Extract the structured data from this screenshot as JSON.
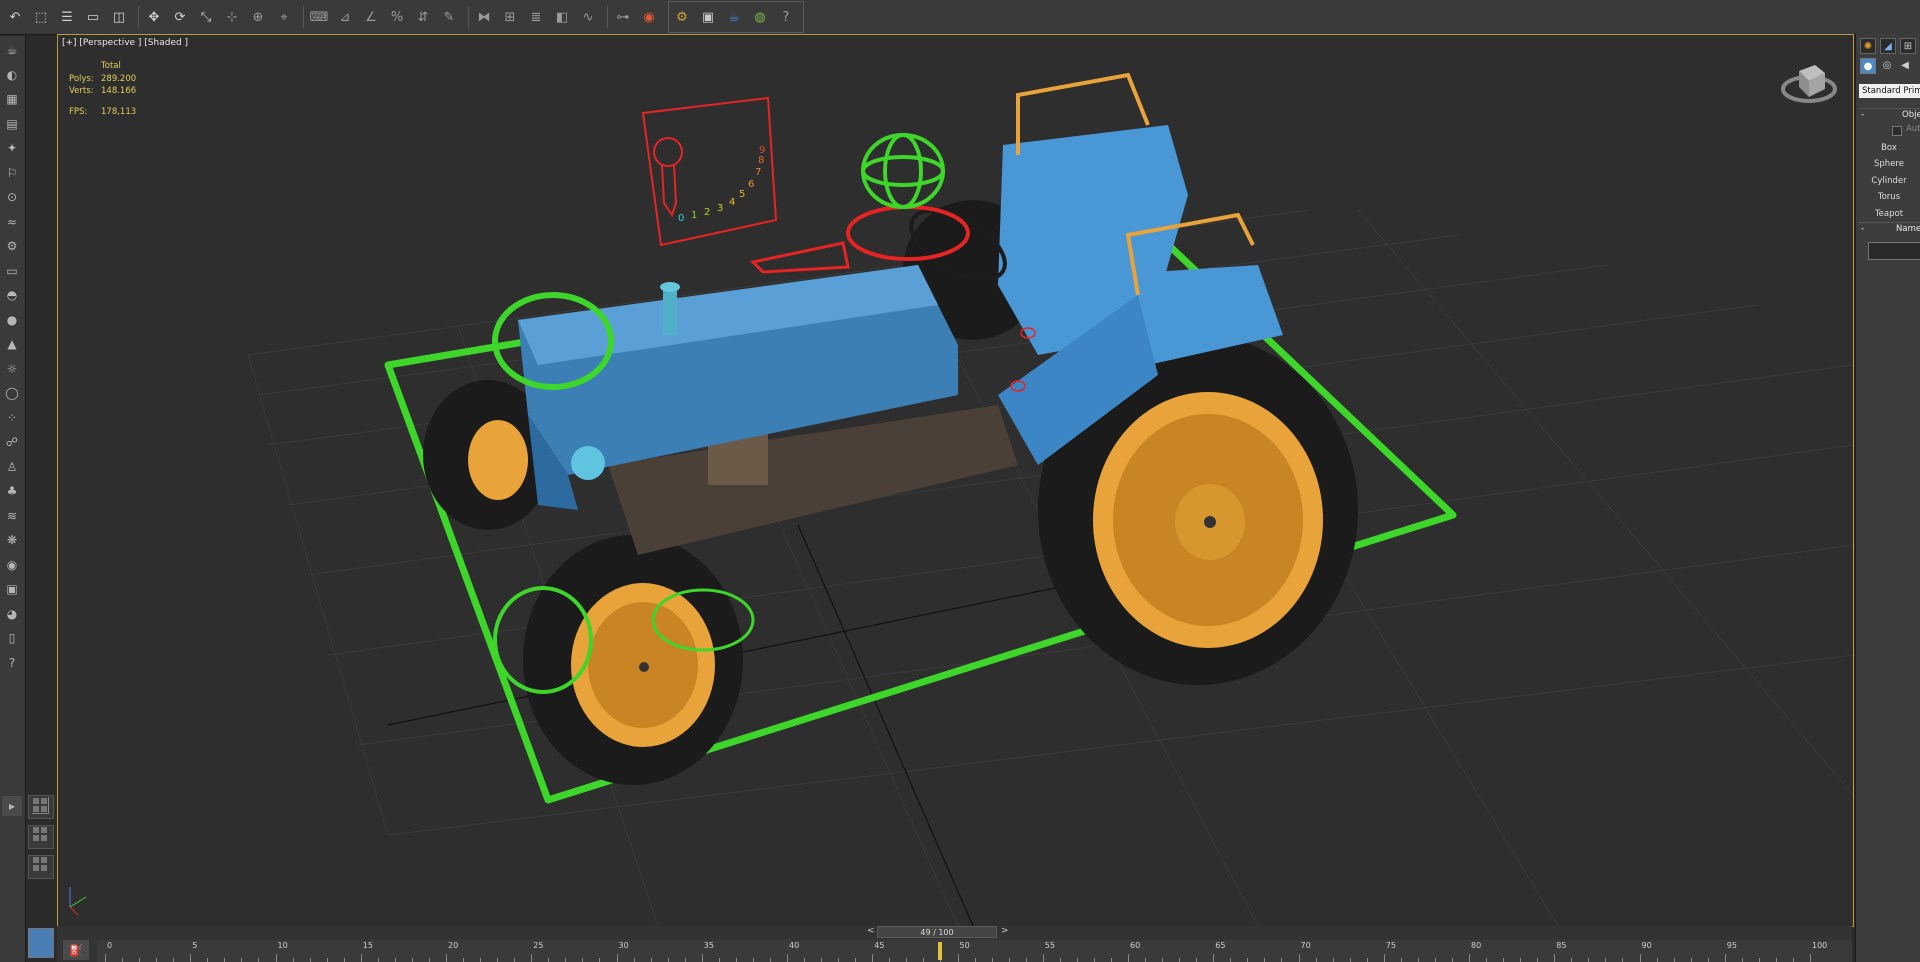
{
  "toolbar": {
    "buttons": [
      "undo-icon",
      "select-object-icon",
      "select-by-name-icon",
      "select-region-icon",
      "window-crossing-icon",
      "move-icon",
      "rotate-icon",
      "scale-icon",
      "reference-coordinate-icon",
      "pivot-icon",
      "select-manipulate-icon",
      "keyboard-shortcut-icon",
      "snap-3d-icon",
      "angle-snap-icon",
      "percent-snap-icon",
      "spinner-snap-icon",
      "named-selection-icon",
      "mirror-icon",
      "align-icon",
      "layer-manager-icon",
      "graphite-icon",
      "curve-editor-icon",
      "schematic-view-icon",
      "material-editor-icon",
      "render-setup-icon",
      "rendered-frame-icon",
      "render-icon",
      "environment-icon",
      "help-icon"
    ]
  },
  "viewport": {
    "label": "[+] [Perspective ] [Shaded ]",
    "stats": {
      "header": "Total",
      "polys_label": "Polys:",
      "polys_value": "289.200",
      "verts_label": "Verts:",
      "verts_value": "148.166",
      "fps_label": "FPS:",
      "fps_value": "178,113"
    },
    "gizmo_numbers": [
      "0",
      "1",
      "2",
      "3",
      "4",
      "5",
      "6",
      "7",
      "8",
      "9"
    ]
  },
  "command_panel": {
    "rollout_object_type": "Obje",
    "autogrid_label": "Auto",
    "dropdown_value": "Standard Primi",
    "primitive_buttons": [
      "Box",
      "Sphere",
      "Cylinder",
      "Torus",
      "Teapot"
    ],
    "rollout_name": "Name a"
  },
  "timeline": {
    "slider_label": "49 / 100",
    "prev_label": "<",
    "next_label": ">",
    "current_frame": 49,
    "ticks": [
      "0",
      "5",
      "10",
      "15",
      "20",
      "25",
      "30",
      "35",
      "40",
      "45",
      "50",
      "55",
      "60",
      "65",
      "70",
      "75",
      "80",
      "85",
      "90",
      "95",
      "100"
    ]
  },
  "colors": {
    "accent_yellow": "#e2cf59",
    "tractor_blue": "#4a97d6",
    "wheel_orange": "#e8a33a",
    "helper_green": "#3ed62a",
    "helper_red": "#e62424"
  }
}
